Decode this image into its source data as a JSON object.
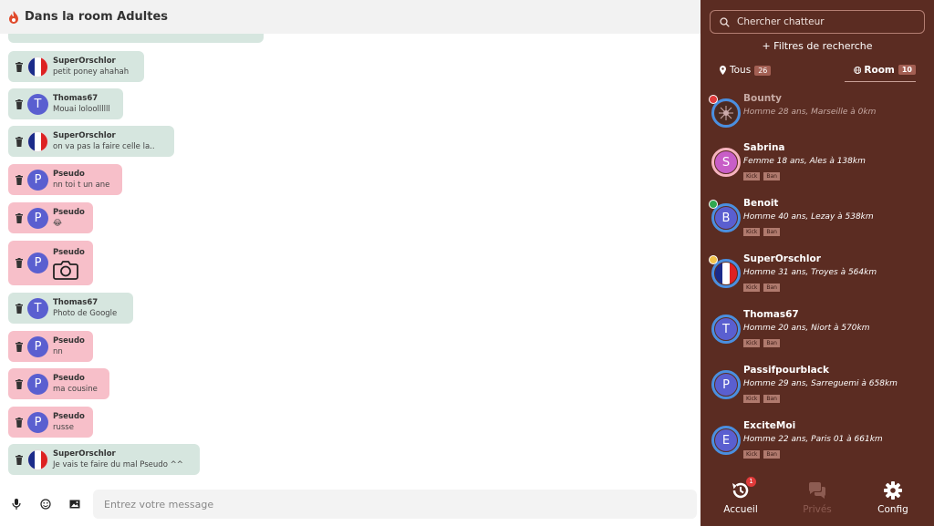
{
  "chat": {
    "title": "Dans la room Adultes",
    "messages": [
      {
        "author": "SuperOrschlor",
        "text": "petit poney ahahah",
        "avatar_type": "flag"
      },
      {
        "author": "Thomas67",
        "text": "Mouai loloollllll",
        "avatar_letter": "T"
      },
      {
        "author": "SuperOrschlor",
        "text": "on va pas la faire celle la..",
        "avatar_type": "flag"
      },
      {
        "author": "Pseudo",
        "text": "nn toi t un ane",
        "avatar_letter": "P"
      },
      {
        "author": "Pseudo",
        "text": "😂",
        "avatar_letter": "P"
      },
      {
        "author": "Pseudo",
        "text": "",
        "avatar_letter": "P",
        "attachment": "camera-icon"
      },
      {
        "author": "Thomas67",
        "text": "Photo de Google",
        "avatar_letter": "T"
      },
      {
        "author": "Pseudo",
        "text": "nn",
        "avatar_letter": "P"
      },
      {
        "author": "Pseudo",
        "text": "ma cousine",
        "avatar_letter": "P"
      },
      {
        "author": "Pseudo",
        "text": "russe",
        "avatar_letter": "P"
      },
      {
        "author": "SuperOrschlor",
        "text": "Je vais te faire du mal Pseudo ^^",
        "avatar_type": "flag"
      }
    ],
    "input_placeholder": "Entrez votre message",
    "icons": [
      "microphone-icon",
      "emoji-icon",
      "image-icon"
    ]
  },
  "panel": {
    "search_placeholder": "Chercher chatteur",
    "filters_label": "+ Filtres de recherche",
    "tabs": [
      {
        "label": "Tous",
        "count": "26"
      },
      {
        "label": "Room",
        "count": "10"
      }
    ],
    "users": [
      {
        "name": "Bounty",
        "info": "Homme 28 ans, Marseille à 0km",
        "status": "red"
      },
      {
        "name": "Sabrina",
        "info": "Femme 18 ans, Ales à 138km",
        "avatar_letter": "S",
        "kick": "Kick",
        "ban": "Ban"
      },
      {
        "name": "Benoit",
        "info": "Homme 40 ans, Lezay à 538km",
        "avatar_letter": "B",
        "status": "green",
        "kick": "Kick",
        "ban": "Ban"
      },
      {
        "name": "SuperOrschlor",
        "info": "Homme 31 ans, Troyes à 564km",
        "status": "yellow",
        "kick": "Kick",
        "ban": "Ban"
      },
      {
        "name": "Thomas67",
        "info": "Homme 20 ans, Niort à 570km",
        "avatar_letter": "T",
        "kick": "Kick",
        "ban": "Ban"
      },
      {
        "name": "Passifpourblack",
        "info": "Homme 29 ans, Sarreguemi à 658km",
        "avatar_letter": "P",
        "kick": "Kick",
        "ban": "Ban"
      },
      {
        "name": "ExciteMoi",
        "info": "Homme 22 ans, Paris 01 à 661km",
        "avatar_letter": "E",
        "kick": "Kick",
        "ban": "Ban"
      }
    ],
    "nav": [
      {
        "label": "Accueil",
        "badge": "1"
      },
      {
        "label": "Privés"
      },
      {
        "label": "Config"
      }
    ]
  },
  "colors": {
    "panel_bg": "#5b2c22",
    "green_bubble": "#d6e6df",
    "pink_bubble": "#f7bfc9",
    "avatar_blue": "#5a5fd0"
  }
}
